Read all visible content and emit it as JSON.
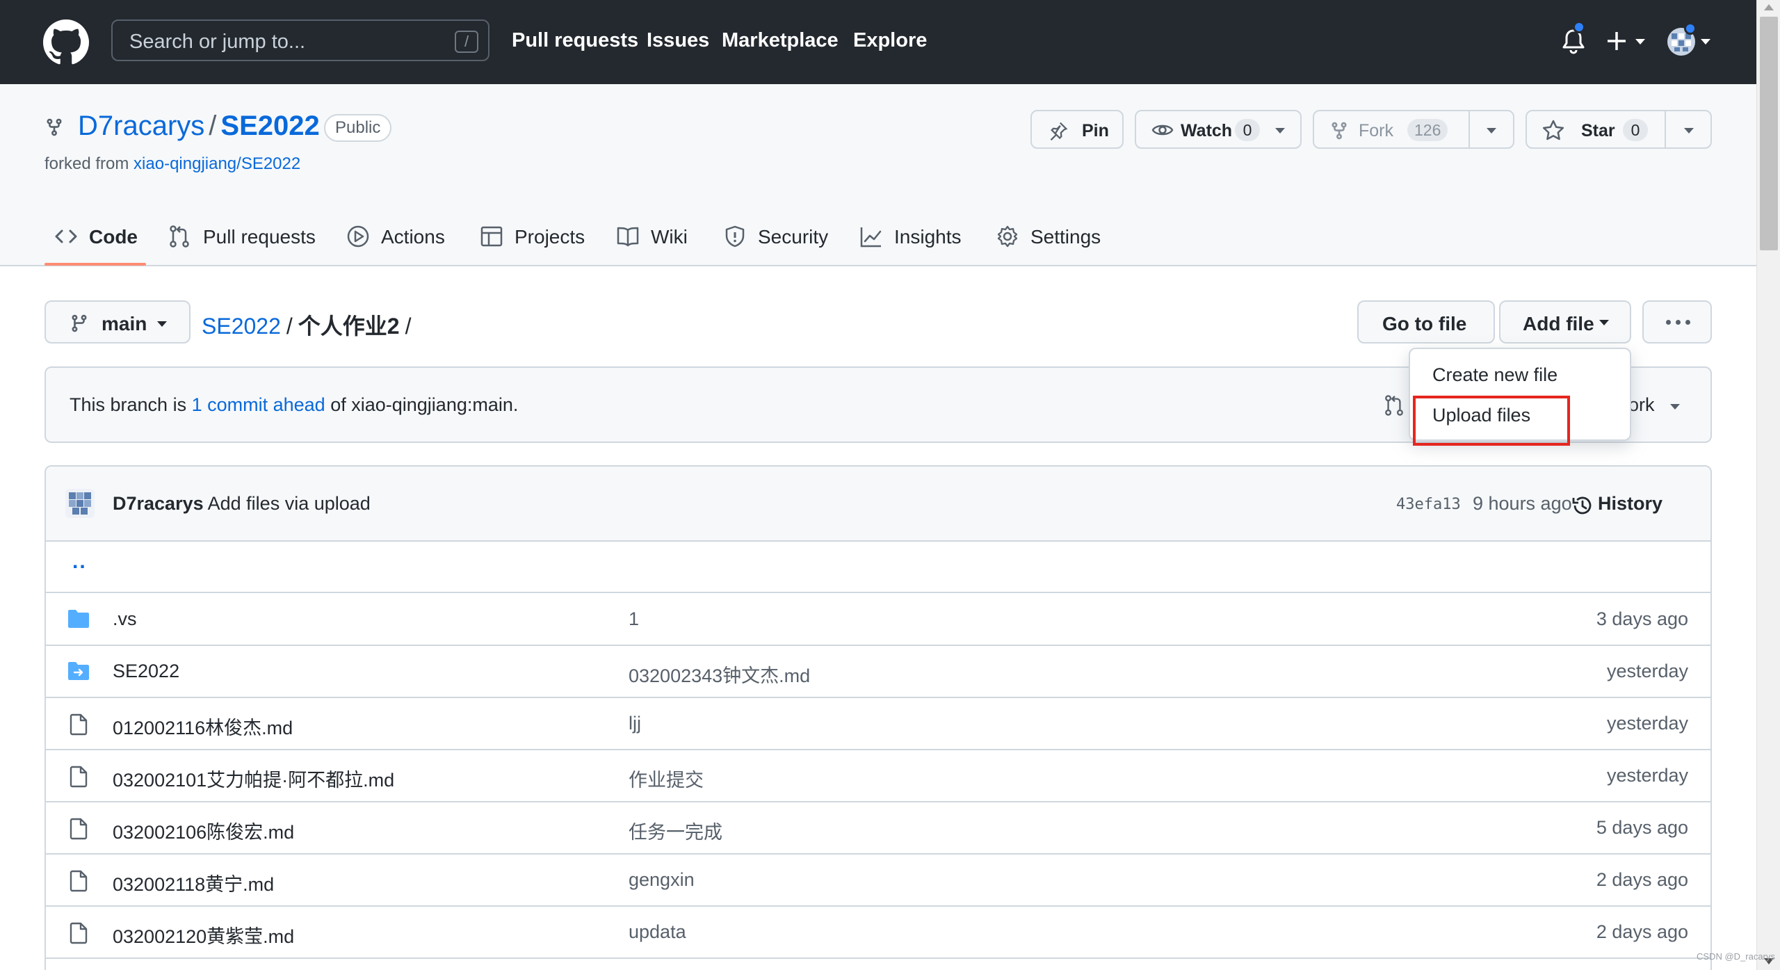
{
  "header": {
    "search_placeholder": "Search or jump to...",
    "search_shortcut": "/",
    "nav": [
      "Pull requests",
      "Issues",
      "Marketplace",
      "Explore"
    ]
  },
  "repo": {
    "owner": "D7racarys",
    "separator": "/",
    "name": "SE2022",
    "visibility": "Public",
    "forked_prefix": "forked from",
    "forked_from": "xiao-qingjiang/SE2022",
    "pin_label": "Pin",
    "watch_label": "Watch",
    "watch_count": "0",
    "fork_label": "Fork",
    "fork_count": "126",
    "star_label": "Star",
    "star_count": "0"
  },
  "tabs": [
    {
      "label": "Code",
      "icon": "code-icon"
    },
    {
      "label": "Pull requests",
      "icon": "pull-request-icon"
    },
    {
      "label": "Actions",
      "icon": "play-icon"
    },
    {
      "label": "Projects",
      "icon": "table-icon"
    },
    {
      "label": "Wiki",
      "icon": "book-icon"
    },
    {
      "label": "Security",
      "icon": "shield-icon"
    },
    {
      "label": "Insights",
      "icon": "graph-icon"
    },
    {
      "label": "Settings",
      "icon": "gear-icon"
    }
  ],
  "filenav": {
    "branch": "main",
    "crumb_repo": "SE2022",
    "crumb_sep": "/",
    "crumb_dir": "个人作业2",
    "crumb_trail": "/",
    "go_to_file": "Go to file",
    "add_file": "Add file"
  },
  "branch_info": {
    "prefix": "This branch is",
    "link": "1 commit ahead",
    "suffix": "of xiao-qingjiang:main.",
    "partial_label": "ork"
  },
  "add_file_menu": {
    "items": [
      "Create new file",
      "Upload files"
    ],
    "highlighted": "Upload files",
    "highlight_color": "#e5261f"
  },
  "latest_commit": {
    "author": "D7racarys",
    "message": "Add files via upload",
    "sha": "43efa13",
    "time": "9 hours ago",
    "history_label": "History"
  },
  "parent_dir": "..",
  "files": [
    {
      "type": "dir",
      "icon": "folder-icon",
      "name": ".vs",
      "commit": "1",
      "age": "3 days ago"
    },
    {
      "type": "submodule",
      "icon": "folder-arrow-icon",
      "name": "SE2022",
      "commit": "032002343钟文杰.md",
      "age": "yesterday"
    },
    {
      "type": "file",
      "icon": "file-icon",
      "name": "012002116林俊杰.md",
      "commit": "ljj",
      "age": "yesterday"
    },
    {
      "type": "file",
      "icon": "file-icon",
      "name": "032002101艾力帕提·阿不都拉.md",
      "commit": "作业提交",
      "age": "yesterday"
    },
    {
      "type": "file",
      "icon": "file-icon",
      "name": "032002106陈俊宏.md",
      "commit": "任务一完成",
      "age": "5 days ago"
    },
    {
      "type": "file",
      "icon": "file-icon",
      "name": "032002118黄宁.md",
      "commit": "gengxin",
      "age": "2 days ago"
    },
    {
      "type": "file",
      "icon": "file-icon",
      "name": "032002120黄紫莹.md",
      "commit": "updata",
      "age": "2 days ago"
    }
  ],
  "watermark": "CSDN @D_racarys",
  "colors": {
    "header_bg": "#24292f",
    "link": "#0969da",
    "folder": "#54aeff",
    "tab_underline": "#fd8c73"
  }
}
